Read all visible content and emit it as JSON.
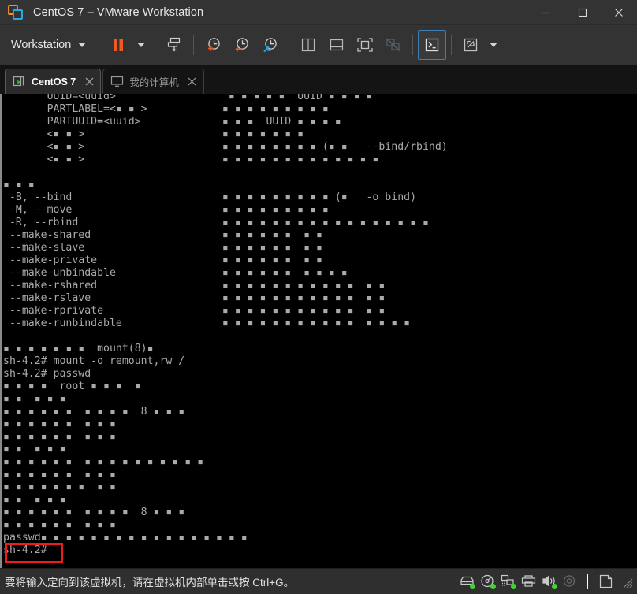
{
  "window": {
    "title": "CentOS 7 – VMware Workstation",
    "logo_icon": "vmware-logo-icon",
    "controls": [
      {
        "name": "minimize-button",
        "icon": "minimize-icon"
      },
      {
        "name": "maximize-button",
        "icon": "maximize-icon"
      },
      {
        "name": "close-button",
        "icon": "close-icon"
      }
    ]
  },
  "toolbar": {
    "menu_label": "Workstation",
    "menu_caret_icon": "chevron-down-icon",
    "buttons": [
      {
        "name": "suspend-vm-button",
        "icon": "pause-icon",
        "tooltip": "Suspend"
      },
      {
        "name": "power-dropdown-button",
        "icon": "chevron-down-icon"
      },
      {
        "name": "send-ctrl-alt-del-button",
        "icon": "send-key-icon"
      },
      {
        "name": "take-snapshot-button",
        "icon": "snapshot-add-icon"
      },
      {
        "name": "revert-snapshot-button",
        "icon": "snapshot-revert-icon"
      },
      {
        "name": "manage-snapshots-button",
        "icon": "snapshot-manager-icon"
      },
      {
        "name": "show-library-button",
        "icon": "panel-left-icon"
      },
      {
        "name": "show-thumbnails-button",
        "icon": "panel-bottom-icon"
      },
      {
        "name": "full-screen-button",
        "icon": "fullscreen-icon"
      },
      {
        "name": "unity-mode-button",
        "icon": "unity-mode-icon",
        "disabled": true
      },
      {
        "name": "console-view-button",
        "icon": "console-icon",
        "active": true
      },
      {
        "name": "stretch-view-button",
        "icon": "expand-arrows-icon"
      },
      {
        "name": "view-dropdown-button",
        "icon": "chevron-down-icon"
      }
    ]
  },
  "tabs": [
    {
      "name": "tab-centos-7",
      "label": "CentOS 7",
      "icon": "vm-running-icon",
      "close_icon": "close-icon",
      "active": true
    },
    {
      "name": "tab-my-computer",
      "label": "我的计算机",
      "icon": "monitor-icon",
      "close_icon": "close-icon",
      "active": false
    }
  ],
  "terminal": {
    "lines": [
      "       UUID=<uuid>                  ▪ ▪ ▪ ▪ ▪  UUID ▪ ▪ ▪ ▪",
      "       PARTLABEL=<▪ ▪ >            ▪ ▪ ▪ ▪ ▪ ▪ ▪ ▪ ▪",
      "       PARTUUID=<uuid>             ▪ ▪ ▪  UUID ▪ ▪ ▪ ▪",
      "       <▪ ▪ >                      ▪ ▪ ▪ ▪ ▪ ▪ ▪",
      "       <▪ ▪ >                      ▪ ▪ ▪ ▪ ▪ ▪ ▪ ▪ (▪ ▪   --bind/rbind)",
      "       <▪ ▪ >                      ▪ ▪ ▪ ▪ ▪ ▪ ▪ ▪ ▪ ▪ ▪ ▪ ▪",
      "",
      "▪ ▪ ▪",
      " -B, --bind                        ▪ ▪ ▪ ▪ ▪ ▪ ▪ ▪ ▪ (▪   -o bind)",
      " -M, --move                        ▪ ▪ ▪ ▪ ▪ ▪ ▪ ▪ ▪",
      " -R, --rbind                       ▪ ▪ ▪ ▪ ▪ ▪ ▪ ▪ ▪ ▪ ▪ ▪ ▪ ▪ ▪ ▪ ▪",
      " --make-shared                     ▪ ▪ ▪ ▪ ▪ ▪  ▪ ▪",
      " --make-slave                      ▪ ▪ ▪ ▪ ▪ ▪  ▪ ▪",
      " --make-private                    ▪ ▪ ▪ ▪ ▪ ▪  ▪ ▪",
      " --make-unbindable                 ▪ ▪ ▪ ▪ ▪ ▪  ▪ ▪ ▪ ▪",
      " --make-rshared                    ▪ ▪ ▪ ▪ ▪ ▪ ▪ ▪ ▪ ▪ ▪  ▪ ▪",
      " --make-rslave                     ▪ ▪ ▪ ▪ ▪ ▪ ▪ ▪ ▪ ▪ ▪  ▪ ▪",
      " --make-rprivate                   ▪ ▪ ▪ ▪ ▪ ▪ ▪ ▪ ▪ ▪ ▪  ▪ ▪",
      " --make-runbindable                ▪ ▪ ▪ ▪ ▪ ▪ ▪ ▪ ▪ ▪ ▪  ▪ ▪ ▪ ▪",
      "",
      "▪ ▪ ▪ ▪ ▪ ▪ ▪  mount(8)▪",
      "sh-4.2# mount -o remount,rw /",
      "sh-4.2# passwd",
      "▪ ▪ ▪ ▪  root ▪ ▪ ▪  ▪",
      "▪ ▪  ▪ ▪ ▪",
      "▪ ▪ ▪ ▪ ▪ ▪  ▪ ▪ ▪ ▪  8 ▪ ▪ ▪",
      "▪ ▪ ▪ ▪ ▪ ▪  ▪ ▪ ▪",
      "▪ ▪ ▪ ▪ ▪ ▪  ▪ ▪ ▪",
      "▪ ▪  ▪ ▪ ▪",
      "▪ ▪ ▪ ▪ ▪ ▪  ▪ ▪ ▪ ▪ ▪ ▪ ▪ ▪ ▪ ▪",
      "▪ ▪ ▪ ▪ ▪ ▪  ▪ ▪ ▪",
      "▪ ▪ ▪ ▪ ▪ ▪ ▪  ▪ ▪",
      "▪ ▪  ▪ ▪ ▪",
      "▪ ▪ ▪ ▪ ▪ ▪  ▪ ▪ ▪ ▪  8 ▪ ▪ ▪",
      "▪ ▪ ▪ ▪ ▪ ▪  ▪ ▪ ▪",
      "passwd▪ ▪ ▪ ▪ ▪ ▪ ▪ ▪ ▪ ▪ ▪ ▪ ▪ ▪ ▪ ▪ ▪",
      "sh-4.2#"
    ],
    "prompt": "sh-4.2#",
    "annotation_color": "#ee1c1c"
  },
  "statusbar": {
    "message": "要将输入定向到该虚拟机，请在虚拟机内部单击或按 Ctrl+G。",
    "devices": [
      {
        "name": "hard-disk-icon",
        "connected": true
      },
      {
        "name": "cd-dvd-icon",
        "connected": true
      },
      {
        "name": "network-adapter-icon",
        "connected": true
      },
      {
        "name": "printer-icon",
        "connected": false
      },
      {
        "name": "sound-card-icon",
        "connected": true
      },
      {
        "name": "usb-device-icon",
        "connected": false
      }
    ],
    "message_icon": "document-icon",
    "resize_grip_icon": "resize-grip-icon"
  },
  "colors": {
    "accent_orange": "#f28b30",
    "accent_blue": "#2aa8e0",
    "annotation_red": "#ee1c1c",
    "led_green": "#3dd62b",
    "terminal_bg": "#000000",
    "terminal_fg": "#aaaaaa"
  }
}
